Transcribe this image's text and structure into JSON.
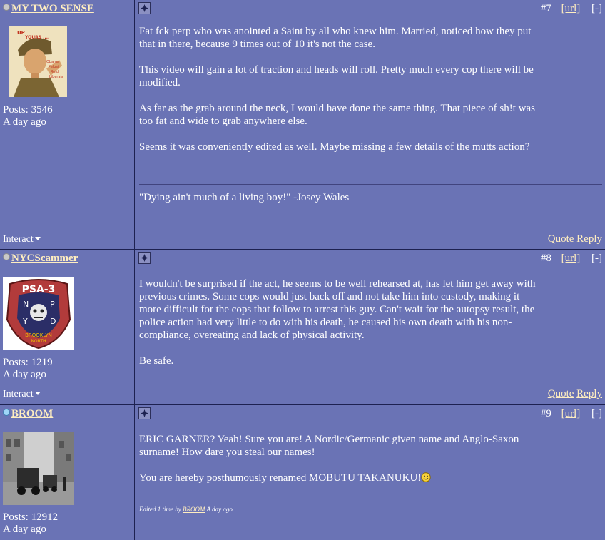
{
  "posts": [
    {
      "username": "MY TWO SENSE",
      "posts_label": "Posts: 3546",
      "time": "A day ago",
      "interact": "Interact",
      "post_number": "#7",
      "url_label": "[url]",
      "collapse_label": "[-]",
      "paragraphs": [
        "Fat fck perp who was anointed a Saint by all who knew him. Married, noticed how they put that in there, because 9 times out of 10 it's not the case.",
        "This video will gain a lot of traction and heads will roll. Pretty much every cop there will be modified.",
        "As far as the grab around the neck, I would have done the same thing. That piece of sh!t was too fat and wide to grab anywhere else.",
        "Seems it was conveniently edited as well. Maybe missing a few details of the mutts action?"
      ],
      "signature": "\"Dying ain't much of a living boy!\" -Josey Wales",
      "quote_label": "Quote",
      "reply_label": "Reply",
      "avatar_text": [
        "UP",
        "YOURS ....",
        "Obama",
        "Pelosi",
        "Reid",
        "Liberals"
      ]
    },
    {
      "username": "NYCScammer",
      "posts_label": "Posts: 1219",
      "time": "A day ago",
      "interact": "Interact",
      "post_number": "#8",
      "url_label": "[url]",
      "collapse_label": "[-]",
      "paragraphs": [
        "I wouldn't be surprised if the act, he seems to be well rehearsed at, has let him get away with previous crimes. Some cops would just back off and not take him into custody, making it more difficult for the cops that follow to arrest this guy. Can't wait for the autopsy result, the police action had very little to do with his death, he caused his own death with his non-compliance, overeating and lack of physical activity.",
        "Be safe."
      ],
      "quote_label": "Quote",
      "reply_label": "Reply",
      "avatar_text": [
        "PSA-3",
        "N",
        "P",
        "Y",
        "D",
        "BROOKLYN",
        "NORTH"
      ]
    },
    {
      "username": "BROOM",
      "posts_label": "Posts: 12912",
      "time": "A day ago",
      "post_number": "#9",
      "url_label": "[url]",
      "collapse_label": "[-]",
      "paragraphs": [
        "ERIC GARNER? Yeah! Sure you are! A Nordic/Germanic given name and Anglo-Saxon surname! How dare you steal our names!",
        "You are hereby posthumously renamed MOBUTU TAKANUKU!"
      ],
      "edited_prefix": "Edited 1 time by",
      "edited_by": "BROOM",
      "edited_suffix": "A day ago."
    }
  ],
  "colors": {
    "background": "#6a73b5",
    "border": "#1d2150",
    "link": "#ffeec0",
    "text": "#ffffff"
  },
  "icons": {
    "offline_status": "grey-dot-icon",
    "online_status": "blue-dot-icon",
    "post_icon": "post-icon",
    "dropdown": "triangle-down-icon",
    "smiley": "smiley-icon"
  }
}
